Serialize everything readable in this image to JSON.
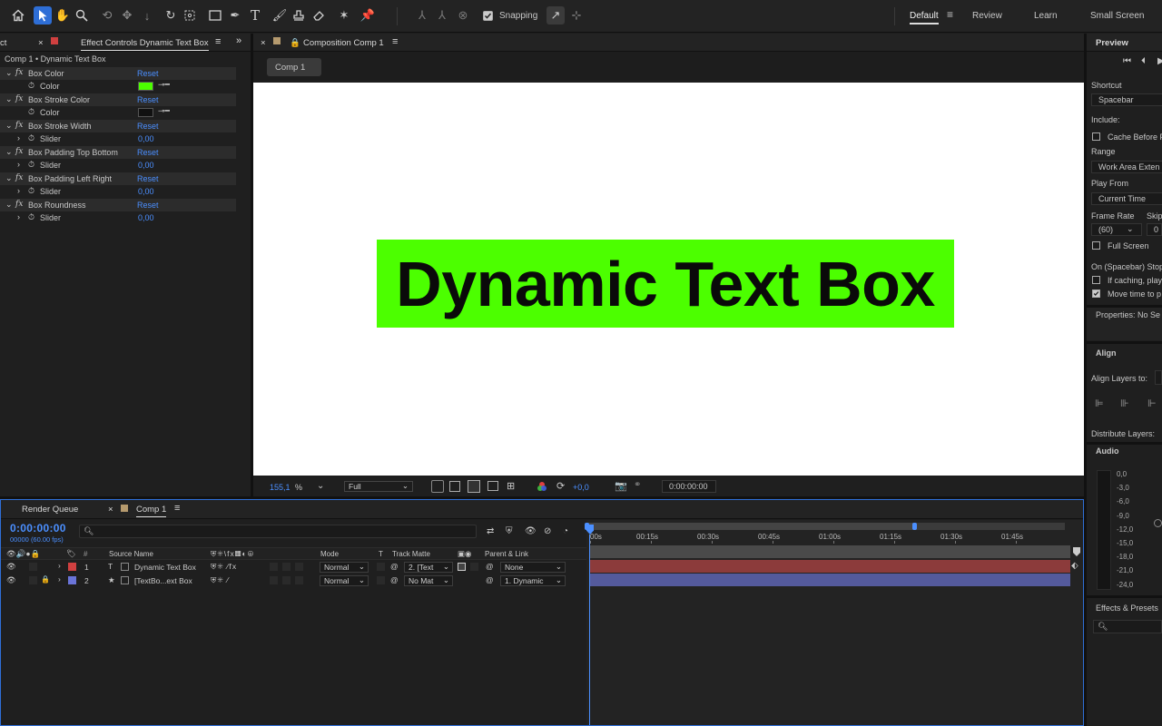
{
  "toolbar": {
    "snapping_label": "Snapping",
    "workspaces": [
      "Default",
      "Review",
      "Learn",
      "Small Screen"
    ]
  },
  "effects_panel": {
    "tab_left_fragment": "ct",
    "tab_label": "Effect Controls Dynamic Text Box",
    "subtitle": "Comp 1 • Dynamic Text Box",
    "effects": [
      {
        "name": "Box Color",
        "reset": "Reset",
        "param": "Color",
        "type": "color",
        "swatch": "#4cff00"
      },
      {
        "name": "Box Stroke Color",
        "reset": "Reset",
        "param": "Color",
        "type": "color",
        "swatch": "#111111"
      },
      {
        "name": "Box Stroke Width",
        "reset": "Reset",
        "param": "Slider",
        "type": "slider",
        "value": "0,00"
      },
      {
        "name": "Box Padding Top Bottom",
        "reset": "Reset",
        "param": "Slider",
        "type": "slider",
        "value": "0,00"
      },
      {
        "name": "Box Padding Left Right",
        "reset": "Reset",
        "param": "Slider",
        "type": "slider",
        "value": "0,00"
      },
      {
        "name": "Box Roundness",
        "reset": "Reset",
        "param": "Slider",
        "type": "slider",
        "value": "0,00"
      }
    ]
  },
  "composition": {
    "tab_label": "Composition Comp 1",
    "flow_label": "Comp 1",
    "canvas_text": "Dynamic Text Box",
    "box_color": "#4cff00",
    "zoom": "155,1",
    "zoom_unit": "%",
    "resolution": "Full",
    "exposure": "+0,0",
    "timecode": "0:00:00:00"
  },
  "timeline": {
    "render_queue_label": "Render Queue",
    "comp_tab_label": "Comp 1",
    "timecode": "0:00:00:00",
    "frame_info": "00000 (60.00 fps)",
    "columns": {
      "hash": "#",
      "source_name": "Source Name",
      "mode": "Mode",
      "t": "T",
      "track_matte": "Track Matte",
      "parent_link": "Parent & Link"
    },
    "ruler": [
      "00s",
      "00:15s",
      "00:30s",
      "00:45s",
      "01:00s",
      "01:15s",
      "01:30s",
      "01:45s"
    ],
    "layers": [
      {
        "num": "1",
        "type": "T",
        "name": "Dynamic Text Box",
        "mode": "Normal",
        "matte": "2. [Text",
        "parent": "None",
        "label_color": "#d04040",
        "bar_color": "#8c3b3b"
      },
      {
        "num": "2",
        "type": "★",
        "name": "[TextBo...ext Box",
        "mode": "Normal",
        "matte": "No Mat",
        "parent": "1. Dynamic",
        "label_color": "#6a74d8",
        "bar_color": "#545a9c"
      }
    ]
  },
  "right_panel": {
    "preview_title": "Preview",
    "shortcut_label": "Shortcut",
    "shortcut_value": "Spacebar",
    "include_label": "Include:",
    "cache_before": "Cache Before P",
    "range_label": "Range",
    "range_value": "Work Area Exten",
    "play_from_label": "Play From",
    "play_from_value": "Current Time",
    "frame_rate_label": "Frame Rate",
    "skip_label": "Skip",
    "frame_rate_value": "(60)",
    "skip_value": "0",
    "full_screen": "Full Screen",
    "on_spacebar": "On (Spacebar) Stop",
    "if_caching": "If caching, play",
    "move_time": "Move time to p",
    "properties": "Properties: No Se",
    "align_title": "Align",
    "align_layers_to": "Align Layers to:",
    "distribute_layers": "Distribute Layers:",
    "audio_title": "Audio",
    "audio_scale": [
      "0,0",
      "-3,0",
      "-6,0",
      "-9,0",
      "-12,0",
      "-15,0",
      "-18,0",
      "-21,0",
      "-24,0"
    ],
    "effects_presets": "Effects & Presets"
  }
}
